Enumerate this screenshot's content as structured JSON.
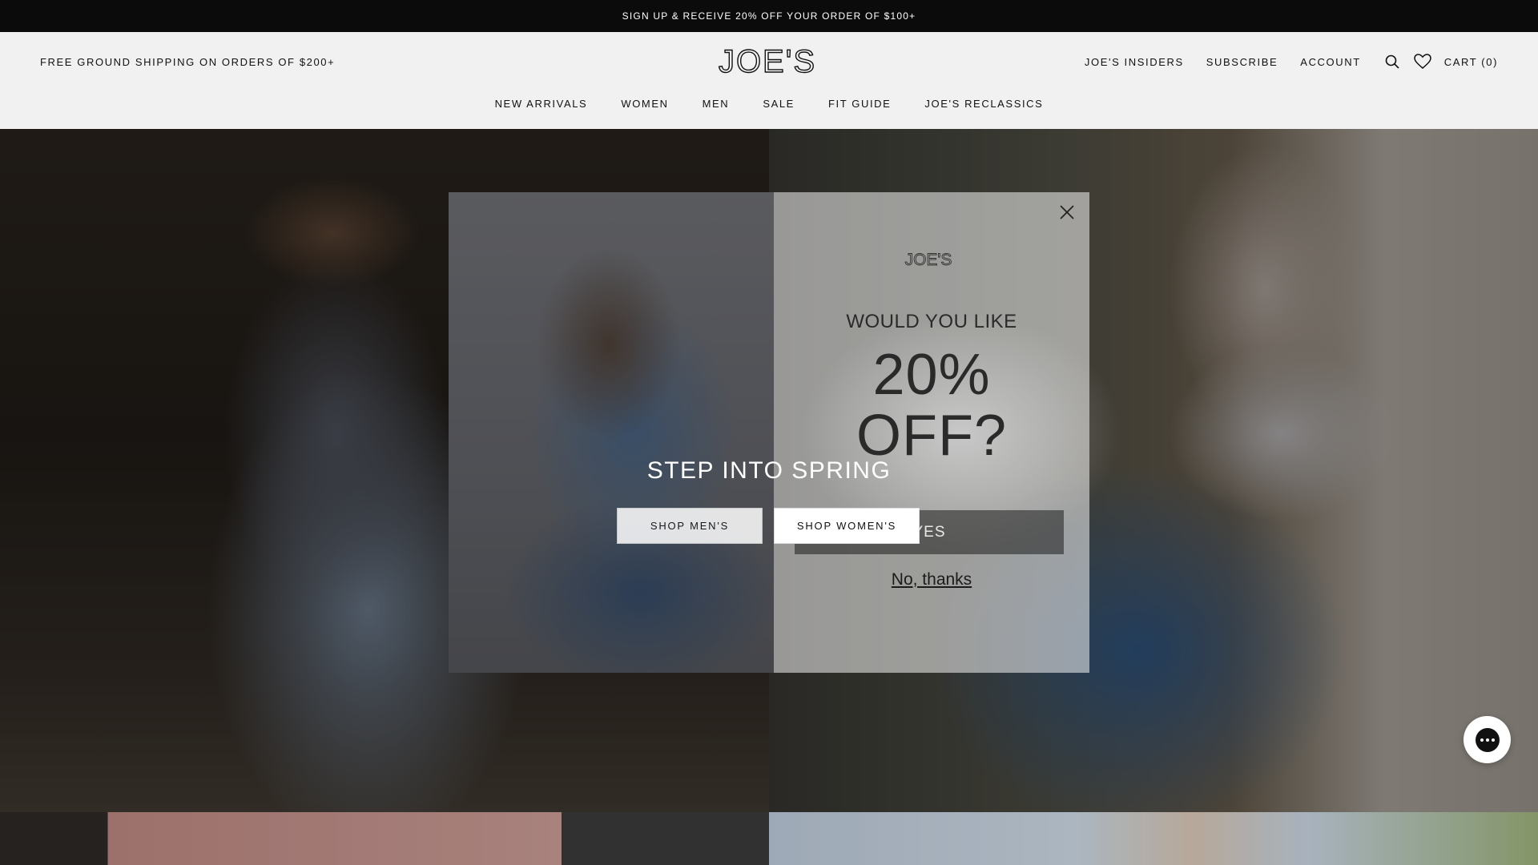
{
  "announcement": {
    "text": "SIGN UP & RECEIVE 20% OFF YOUR ORDER OF $100+"
  },
  "header": {
    "shipping_note": "FREE GROUND SHIPPING ON ORDERS OF $200+",
    "logo_text": "JOE'S",
    "utility_links": [
      "JOE'S INSIDERS",
      "SUBSCRIBE",
      "ACCOUNT"
    ],
    "cart_label": "CART (0)",
    "icons": [
      "search-icon",
      "heart-icon"
    ]
  },
  "nav": {
    "items": [
      "NEW ARRIVALS",
      "WOMEN",
      "MEN",
      "SALE",
      "FIT GUIDE",
      "JOE'S RECLASSICS"
    ]
  },
  "hero": {
    "title": "STEP INTO SPRING",
    "cta_mens": "SHOP MEN'S",
    "cta_womens": "SHOP WOMEN'S"
  },
  "modal": {
    "logo_text": "JOE'S",
    "kicker": "WOULD YOU LIKE",
    "offer_line1": "20%",
    "offer_line2": "OFF?",
    "yes_label": "YES",
    "no_label": "No, thanks",
    "close_icon": "close-icon"
  },
  "chat": {
    "icon": "chat-icon"
  }
}
